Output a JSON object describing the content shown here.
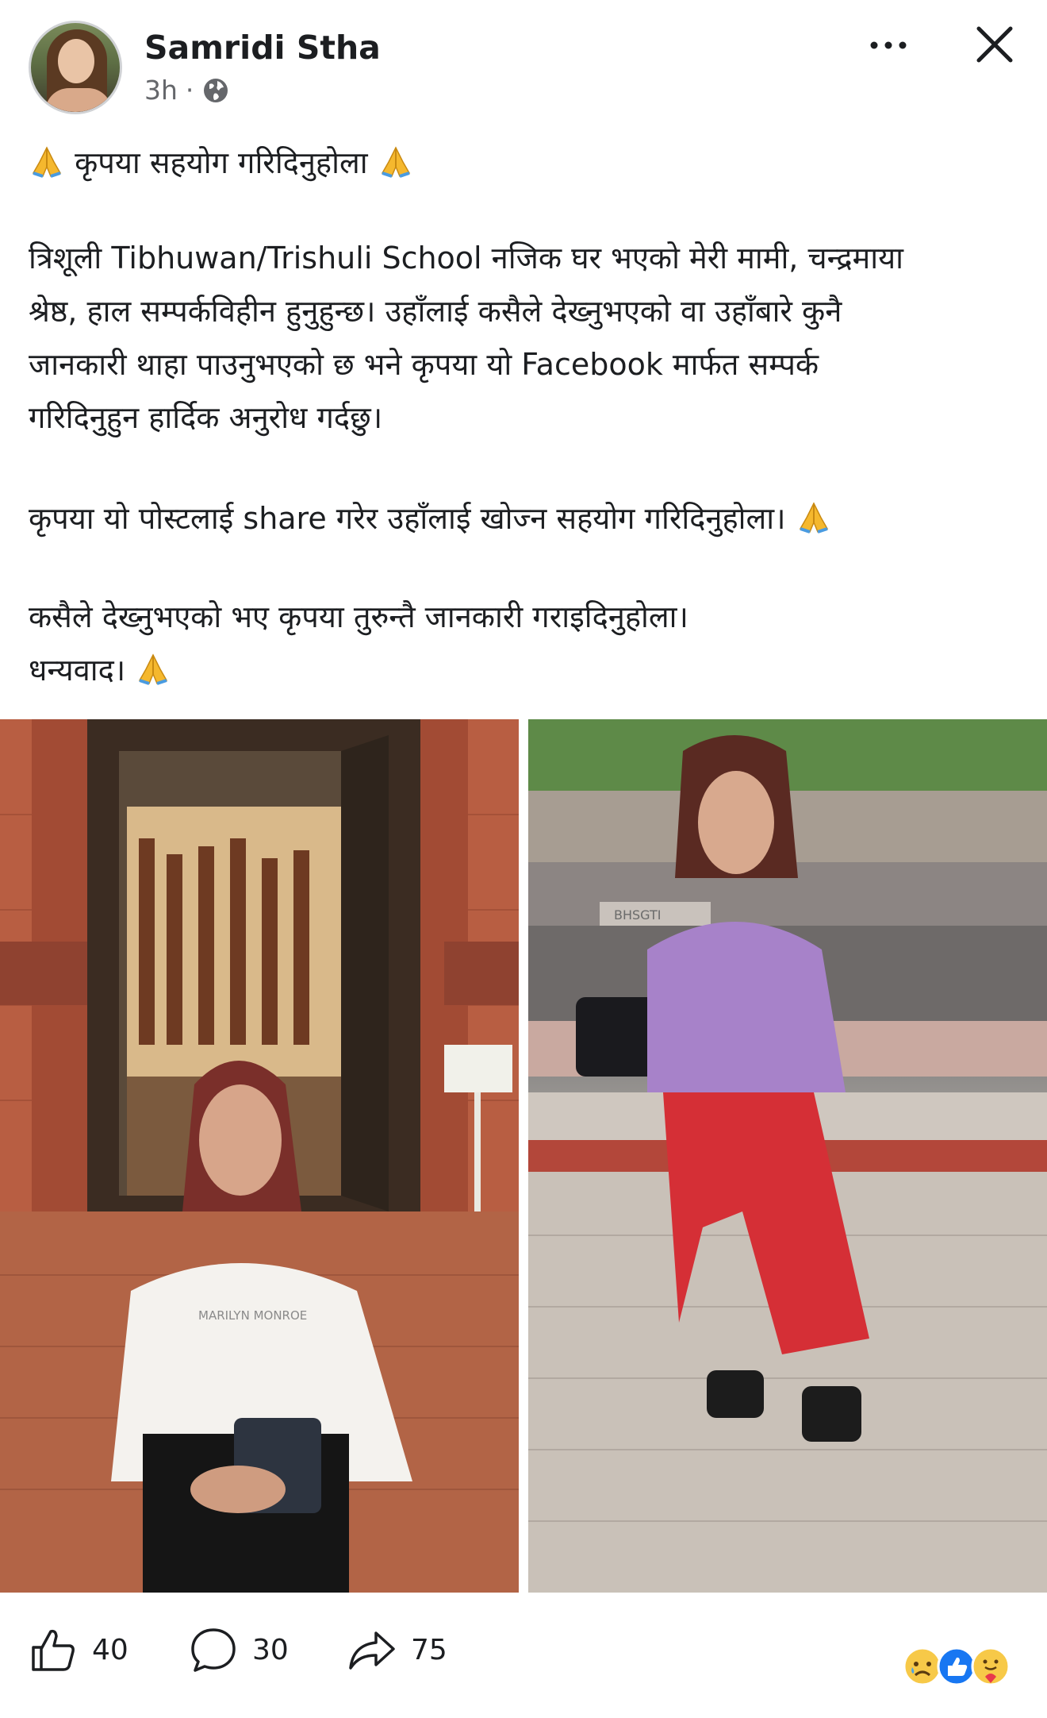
{
  "post": {
    "author": "Samridi Stha",
    "time": "3h",
    "separator": "·",
    "privacy_icon": "globe-icon",
    "line1": "कृपया सहयोग गरिदिनुहोला",
    "para1_l1": "त्रिशूली Tibhuwan/Trishuli School नजिक घर भएको मेरी मामी, चन्द्रमाया",
    "para1_l2": "श्रेष्ठ, हाल सम्पर्कविहीन हुनुहुन्छ। उहाँलाई कसैले देख्नुभएको वा उहाँबारे कुनै",
    "para1_l3": "जानकारी थाहा पाउनुभएको छ भने कृपया यो Facebook मार्फत सम्पर्क",
    "para1_l4": "गरिदिनुहुन हार्दिक अनुरोध गर्दछु।",
    "para2": "कृपया यो पोस्टलाई share गरेर उहाँलाई खोज्न सहयोग गरिदिनुहोला।",
    "para3_l1": "कसैले देख्नुभएको भए कृपया तुरुन्तै जानकारी गराइदिनुहोला।",
    "para3_l2": "धन्यवाद।",
    "emoji": "folded-hands-emoji"
  },
  "photos": {
    "photo1_shirt_text": "MARILYN MONROE",
    "photo2_sign_text": "BHSGTI"
  },
  "footer": {
    "likes": "40",
    "comments": "30",
    "shares": "75",
    "reaction_icons": [
      "sad-emoji",
      "like-emoji",
      "care-emoji"
    ]
  },
  "colors": {
    "text": "#1c1e21",
    "secondary": "#65676b",
    "like_blue": "#1877f2"
  }
}
